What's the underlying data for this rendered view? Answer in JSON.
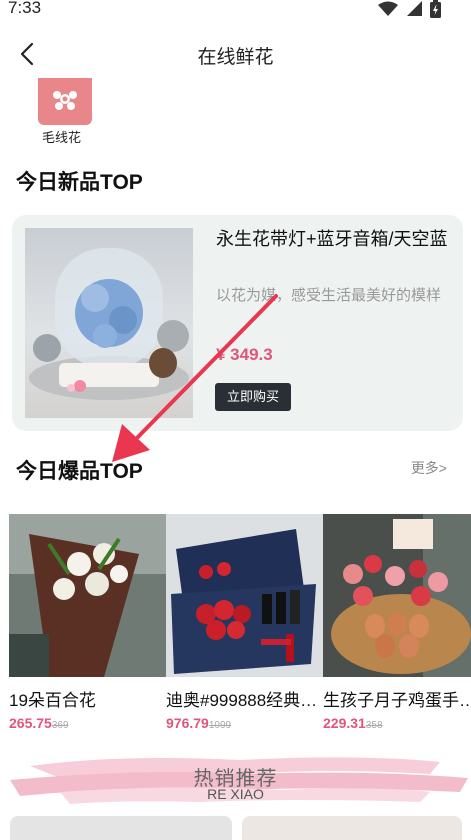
{
  "status": {
    "time": "7:33"
  },
  "nav": {
    "title": "在线鲜花"
  },
  "category": {
    "label": "毛线花"
  },
  "new_section": {
    "title": "今日新品TOP",
    "product": {
      "name": "永生花带灯+蓝牙音箱/天空蓝",
      "desc": "以花为媒，感受生活最美好的模样",
      "price": "¥ 349.3",
      "buy_label": "立即购买"
    }
  },
  "hot_section": {
    "title": "今日爆品TOP",
    "more": "更多>",
    "items": [
      {
        "name": "19朵百合花",
        "price": "265.75",
        "old_price": "369"
      },
      {
        "name": "迪奥#999888经典…",
        "price": "976.79",
        "old_price": "1099"
      },
      {
        "name": "生孩子月子鸡蛋手…",
        "price": "229.31",
        "old_price": "358"
      }
    ]
  },
  "banner": {
    "title": "热销推荐",
    "subtitle": "RE XIAO"
  },
  "colors": {
    "accent": "#e2557b",
    "card_bg": "#eef2f1",
    "button_dark": "#2a2f36",
    "arrow": "#e8374e"
  }
}
